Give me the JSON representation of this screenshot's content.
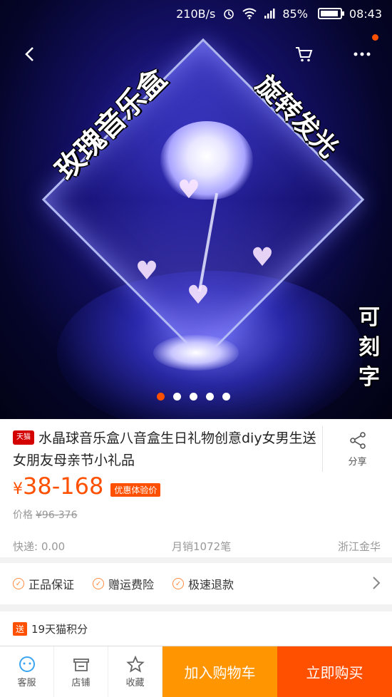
{
  "status_bar": {
    "speed": "210B/s",
    "battery": "85%",
    "time": "08:43"
  },
  "hero": {
    "text_left": "玫瑰音乐盒",
    "text_right": "旋转发光",
    "text_vertical": "可刻字",
    "carousel_count": 5,
    "carousel_active": 1
  },
  "product": {
    "badge": "天猫",
    "title": "水晶球音乐盒八音盒生日礼物创意diy女男生送女朋友母亲节小礼品",
    "share_label": "分享",
    "price_symbol": "¥",
    "price": "38-168",
    "promo_tag": "优惠体验价",
    "orig_label": "价格",
    "orig_price": "¥96-376",
    "shipping": "快递: 0.00",
    "monthly_sales": "月销1072笔",
    "location": "浙江金华"
  },
  "guarantees": [
    "正品保证",
    "赠运费险",
    "极速退款"
  ],
  "points": {
    "tag": "送",
    "text": "19天猫积分"
  },
  "bottom_bar": {
    "service": "客服",
    "shop": "店铺",
    "favorite": "收藏",
    "add_cart": "加入购物车",
    "buy_now": "立即购买"
  },
  "colors": {
    "accent": "#ff5000",
    "cart": "#ff9500"
  }
}
